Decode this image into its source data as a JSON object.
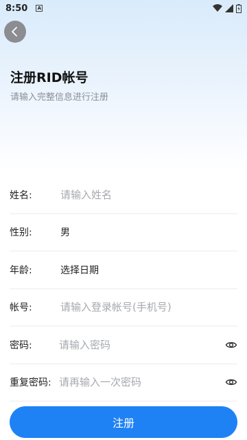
{
  "status_bar": {
    "time": "8:50",
    "notification": "A"
  },
  "header": {
    "title": "注册RID帐号",
    "subtitle": "请输入完整信息进行注册"
  },
  "form": {
    "name": {
      "label": "姓名:",
      "placeholder": "请输入姓名"
    },
    "gender": {
      "label": "性别:",
      "value": "男"
    },
    "age": {
      "label": "年龄:",
      "value": "选择日期"
    },
    "account": {
      "label": "帐号:",
      "placeholder": "请输入登录帐号(手机号)"
    },
    "password": {
      "label": "密码:",
      "placeholder": "请输入密码"
    },
    "confirm_password": {
      "label": "重复密码:",
      "placeholder": "请再输入一次密码"
    }
  },
  "submit": {
    "label": "注册"
  },
  "colors": {
    "accent": "#1e82f5",
    "back_button": "#8b8d91"
  }
}
